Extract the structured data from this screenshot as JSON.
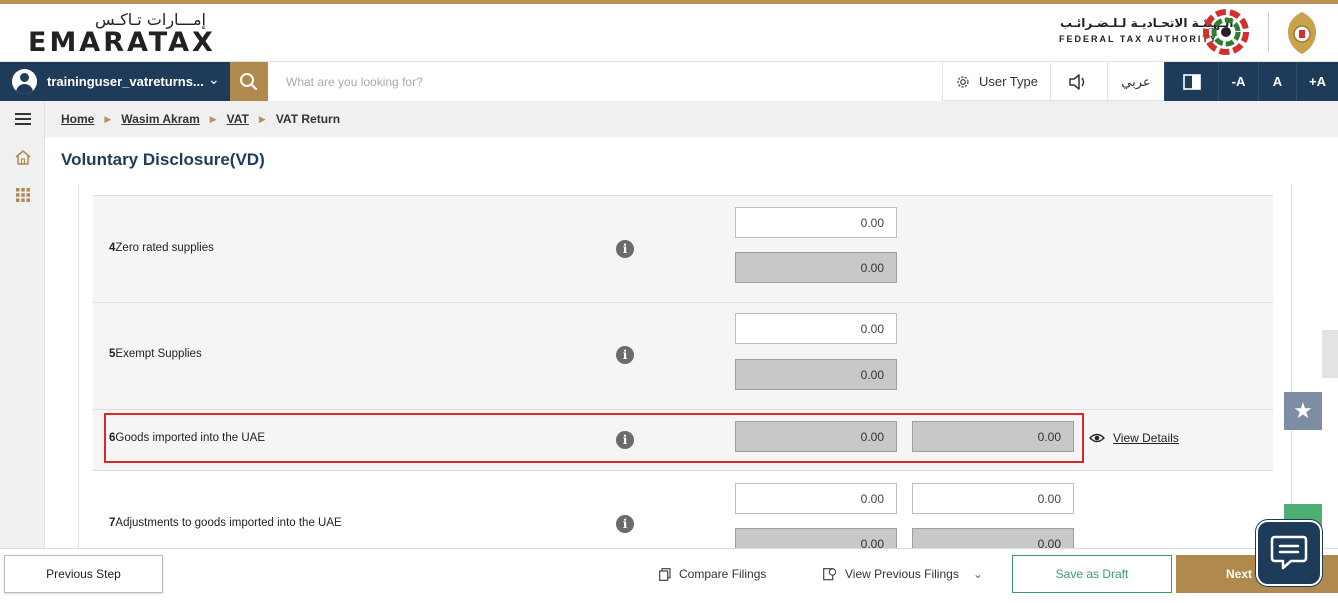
{
  "header": {
    "logo_ar": "إمـــارات تـاكـس",
    "logo_en": "EMARATAX",
    "authority_ar": "الـهيئـة الاتحـاديـة لـلـضـرائـب",
    "authority_en": "FEDERAL TAX AUTHORITY"
  },
  "navbar": {
    "username": "traininguser_vatreturns...",
    "search_placeholder": "What are you looking for?",
    "user_type_label": "User Type",
    "language_label": "عربي",
    "font_decrease": "-A",
    "font_normal": "A",
    "font_increase": "+A"
  },
  "breadcrumb": {
    "items": [
      "Home",
      "Wasim Akram",
      "VAT"
    ],
    "current": "VAT Return"
  },
  "page_title": "Voluntary Disclosure(VD)",
  "rows": [
    {
      "num": "4",
      "label": "Zero rated supplies",
      "field1": "0.00",
      "field2": "0.00"
    },
    {
      "num": "5",
      "label": "Exempt Supplies",
      "field1": "0.00",
      "field2": "0.00"
    },
    {
      "num": "6",
      "label": "Goods imported into the UAE",
      "field1": "0.00",
      "field2": "0.00",
      "link": "View Details"
    },
    {
      "num": "7",
      "label": "Adjustments to goods imported into the UAE",
      "field1": "0.00",
      "field2": "0.00",
      "field3": "0.00",
      "field4": "0.00"
    }
  ],
  "footer": {
    "previous_step": "Previous Step",
    "compare_filings": "Compare Filings",
    "view_previous_filings": "View Previous Filings",
    "save_as_draft": "Save as Draft",
    "next": "Next"
  },
  "colors": {
    "navy": "#1f3b5a",
    "gold": "#b0894e",
    "highlight_red": "#d42a2a",
    "green": "#3a9b6a"
  }
}
